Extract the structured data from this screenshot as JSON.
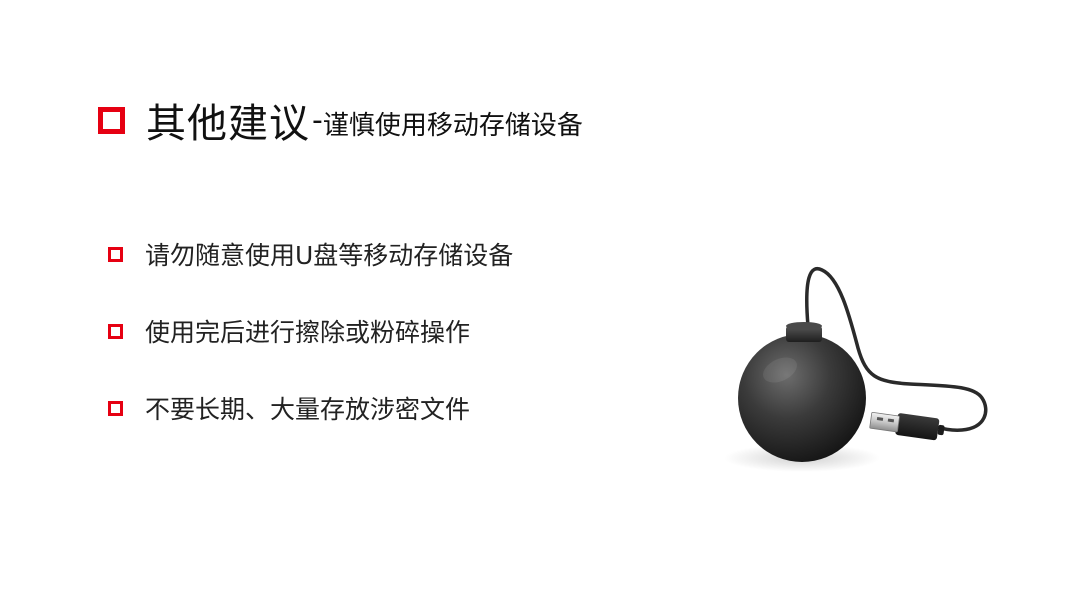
{
  "slide": {
    "title_main": "其他建议",
    "title_separator": "-",
    "title_sub": "谨慎使用移动存储设备",
    "accent_color": "#e60012",
    "bullets": [
      {
        "text": "请勿随意使用U盘等移动存储设备"
      },
      {
        "text": "使用完后进行擦除或粉碎操作"
      },
      {
        "text": "不要长期、大量存放涉密文件"
      }
    ],
    "image": {
      "icon": "usb-bomb-icon"
    }
  }
}
